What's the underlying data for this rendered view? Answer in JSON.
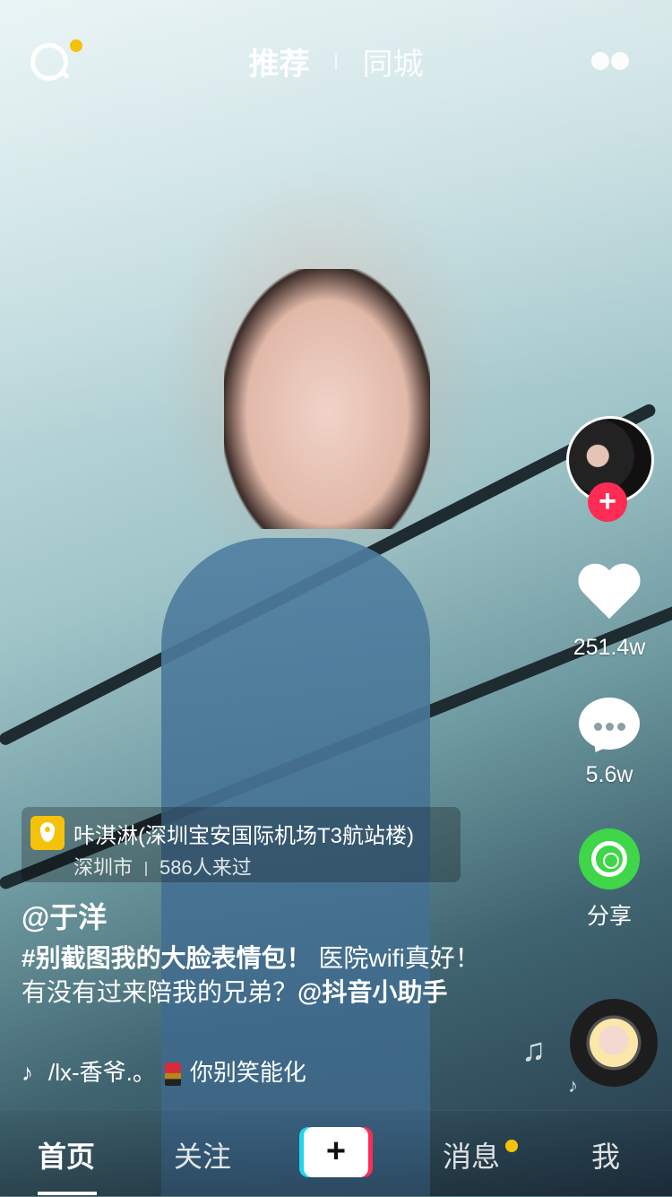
{
  "top": {
    "tabs": [
      "推荐",
      "同城"
    ],
    "active_tab": "推荐"
  },
  "sidebar": {
    "likes": "251.4w",
    "comments": "5.6w",
    "share_label": "分享",
    "follow_symbol": "+"
  },
  "post": {
    "location_name": "咔淇淋(深圳宝安国际机场T3航站楼)",
    "location_city": "深圳市",
    "visitors": "586人来过",
    "username": "@于洋",
    "caption_hashtag": "#别截图我的大脸表情包！",
    "caption_text": " 医院wifi真好！有没有过来陪我的兄弟？",
    "caption_mention": "@抖音小助手",
    "music_text_1": "/lx-香爷.。",
    "music_text_2": "你别笑能化"
  },
  "nav": {
    "home": "首页",
    "follow": "关注",
    "create": "+",
    "messages": "消息",
    "me": "我"
  },
  "colors": {
    "accent_red": "#fe2c55",
    "accent_cyan": "#20d5ec",
    "badge_yellow": "#f5c20a",
    "share_green": "#3fd64a"
  },
  "icons": {
    "search": "search-icon",
    "live": "live-icon",
    "like": "heart-icon",
    "comment": "comment-icon",
    "share": "share-icon",
    "music": "music-note-icon",
    "location": "location-pin-icon"
  }
}
